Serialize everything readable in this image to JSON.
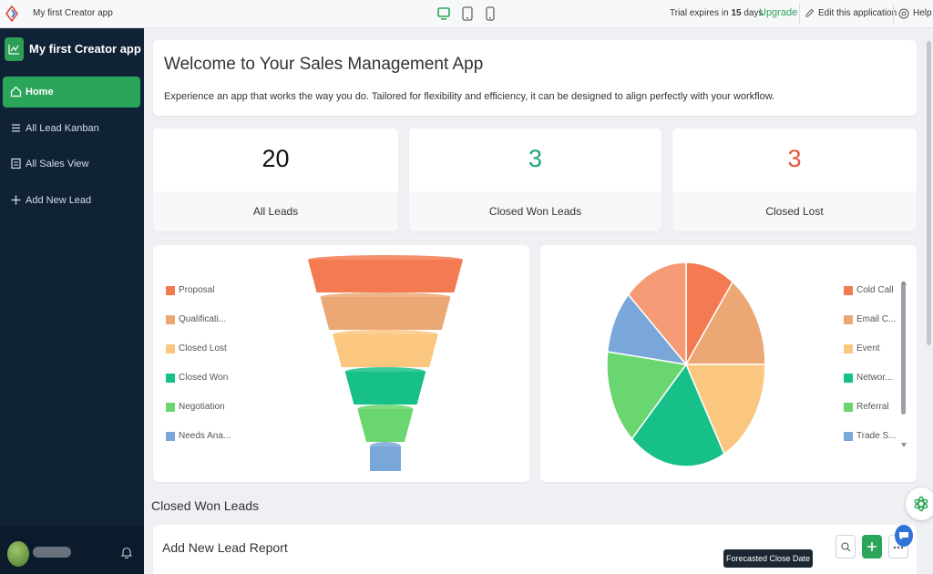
{
  "topbar": {
    "app_title": "My first Creator app",
    "trial_prefix": "Trial expires in",
    "trial_days": "15",
    "trial_suffix": "days",
    "upgrade": "Upgrade",
    "edit": "Edit this application",
    "help": "Help"
  },
  "sidebar": {
    "app_name": "My first Creator app",
    "items": [
      {
        "label": "Home",
        "icon": "home-icon",
        "active": true
      },
      {
        "label": "All Lead Kanban",
        "icon": "list-icon"
      },
      {
        "label": "All Sales View",
        "icon": "report-icon"
      },
      {
        "label": "Add New Lead",
        "icon": "plus-icon"
      }
    ]
  },
  "welcome": {
    "title": "Welcome to Your Sales Management App",
    "subtitle": "Experience an app that works the way you do. Tailored for flexibility and efficiency, it can be designed to align perfectly with your workflow."
  },
  "kpis": [
    {
      "value": "20",
      "label": "All Leads",
      "color": "#111111"
    },
    {
      "value": "3",
      "label": "Closed Won Leads",
      "color": "#1fa37a"
    },
    {
      "value": "3",
      "label": "Closed Lost",
      "color": "#e8543f"
    }
  ],
  "chart_data": [
    {
      "type": "funnel",
      "series": [
        {
          "name": "Proposal",
          "color": "#f47a52"
        },
        {
          "name": "Qualificati...",
          "color": "#eba875"
        },
        {
          "name": "Closed Lost",
          "color": "#fbc780"
        },
        {
          "name": "Closed Won",
          "color": "#17c089"
        },
        {
          "name": "Negotiation",
          "color": "#6ad66f"
        },
        {
          "name": "Needs Ana...",
          "color": "#7aa7d9"
        }
      ]
    },
    {
      "type": "pie",
      "series": [
        {
          "name": "Cold Call",
          "color": "#f47a52",
          "value": 10
        },
        {
          "name": "Email C...",
          "color": "#eba875",
          "value": 15
        },
        {
          "name": "Event",
          "color": "#fbc780",
          "value": 17
        },
        {
          "name": "Networ...",
          "color": "#17c089",
          "value": 20
        },
        {
          "name": "Referral",
          "color": "#6ad66f",
          "value": 15
        },
        {
          "name": "Trade S...",
          "color": "#7aa7d9",
          "value": 10
        },
        {
          "name": "",
          "color": "#f59b76",
          "value": 13
        }
      ]
    }
  ],
  "section": {
    "closed_won_title": "Closed Won Leads"
  },
  "report": {
    "title": "Add New Lead Report"
  },
  "tooltip": "Forecasted Close Date"
}
